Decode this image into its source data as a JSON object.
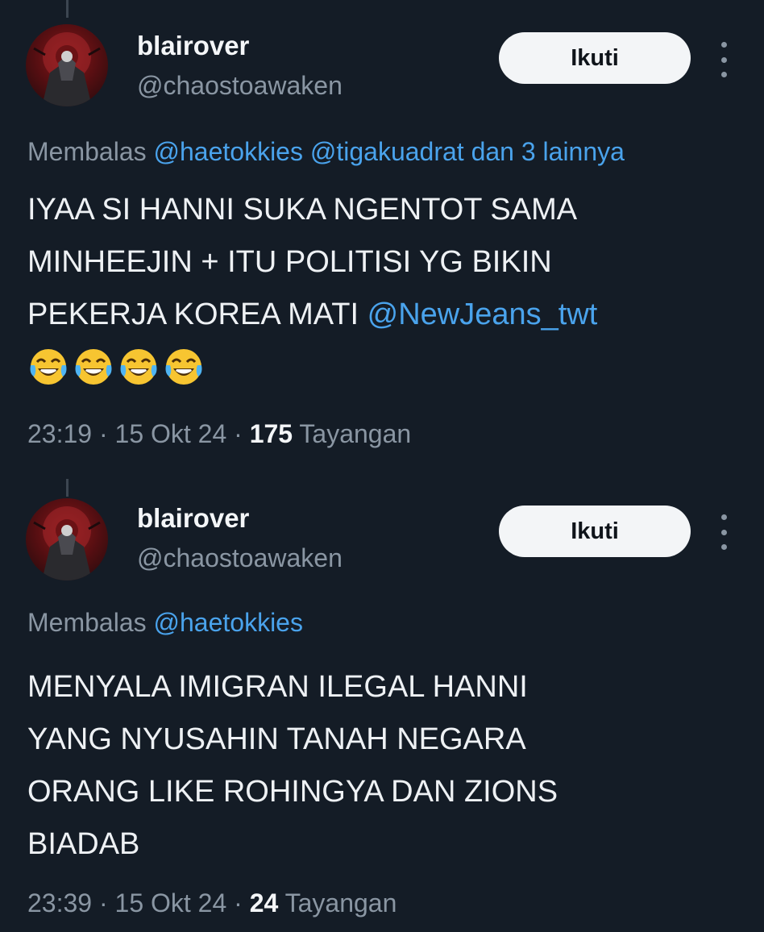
{
  "tweets": [
    {
      "display_name": "blairover",
      "handle": "@chaostoawaken",
      "follow_label": "Ikuti",
      "reply_prefix": "Membalas",
      "reply_mentions": "@haetokkies @tigakuadrat dan 3 lainnya",
      "text_lines": [
        "IYAA SI HANNI SUKA NGENTOT SAMA",
        "MINHEEJIN + ITU POLITISI YG BIKIN",
        "PEKERJA KOREA MATI"
      ],
      "text_mention": "@NewJeans_twt",
      "emojis": [
        "😂",
        "😂",
        "😂",
        "😂"
      ],
      "time": "23:19",
      "date": "15 Okt 24",
      "views": "175",
      "views_label": "Tayangan",
      "separator": "·"
    },
    {
      "display_name": "blairover",
      "handle": "@chaostoawaken",
      "follow_label": "Ikuti",
      "reply_prefix": "Membalas",
      "reply_mentions": "@haetokkies",
      "text_lines": [
        "MENYALA IMIGRAN ILEGAL HANNI",
        "YANG NYUSAHIN TANAH NEGARA",
        "ORANG LIKE ROHINGYA DAN ZIONS",
        "BIADAB"
      ],
      "time": "23:39",
      "date": "15 Okt 24",
      "views": "24",
      "views_label": "Tayangan",
      "separator": "·"
    }
  ],
  "colors": {
    "background": "#141c26",
    "mention": "#4aa3ec",
    "muted": "#8a96a3",
    "follow_button_bg": "#f3f5f7"
  },
  "icons": {
    "more": "more-vertical-icon",
    "avatar": "avatar-image"
  }
}
